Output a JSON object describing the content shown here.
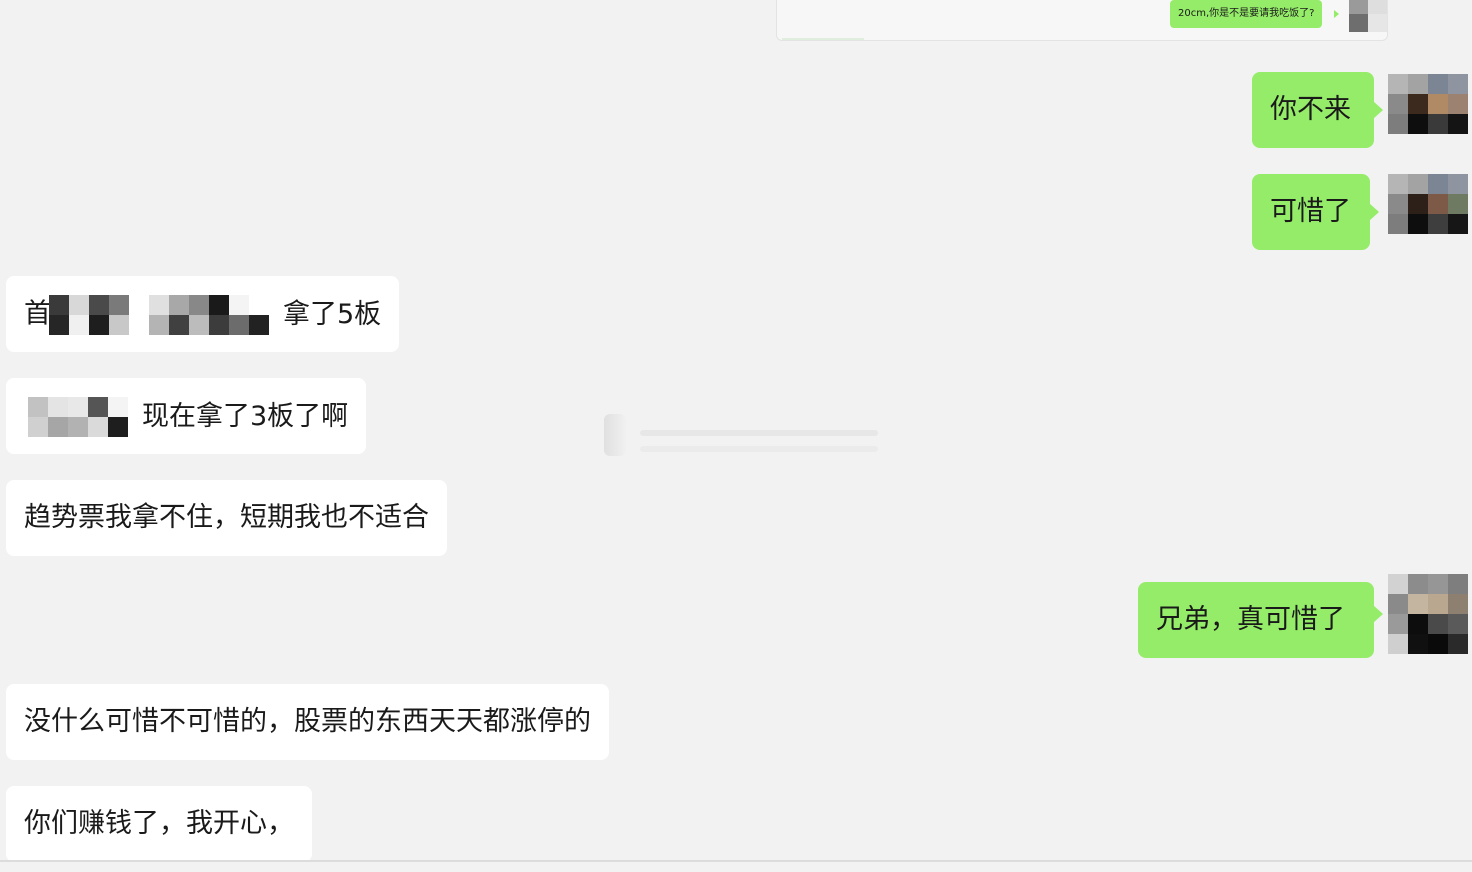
{
  "quoted_message": {
    "text": "20cm,你是不是要请我吃饭了?"
  },
  "messages": [
    {
      "side": "out",
      "text": "你不来"
    },
    {
      "side": "out",
      "text": "可惜了"
    },
    {
      "side": "in",
      "prefix": "首",
      "suffix": "拿了5板"
    },
    {
      "side": "in",
      "suffix": "现在拿了3板了啊"
    },
    {
      "side": "in",
      "text": "趋势票我拿不住，短期我也不适合"
    },
    {
      "side": "out",
      "text": "兄弟，真可惜了"
    },
    {
      "side": "in",
      "text": "没什么可惜不可惜的，股票的东西天天都涨停的"
    },
    {
      "side": "in",
      "text": "你们赚钱了，我开心，"
    }
  ],
  "colors": {
    "background": "#f2f2f2",
    "outgoing_bubble": "#95ec69",
    "incoming_bubble": "#ffffff",
    "text": "#1a1a1a"
  }
}
